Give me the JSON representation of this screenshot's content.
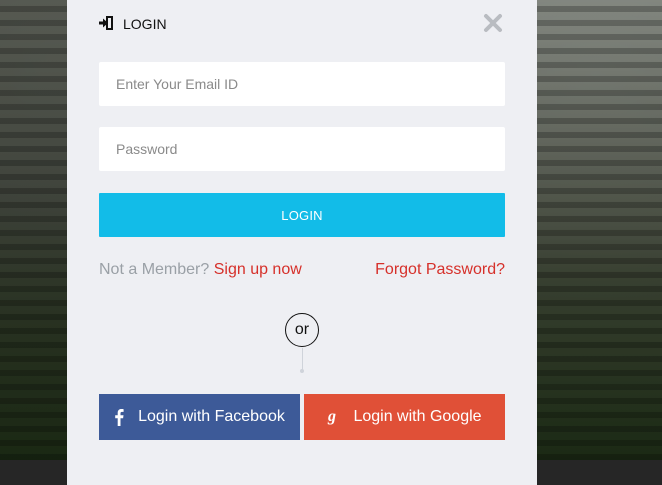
{
  "modal": {
    "title": "LOGIN",
    "email_placeholder": "Enter Your Email ID",
    "password_placeholder": "Password",
    "login_button": "LOGIN",
    "not_member_text": "Not a Member?",
    "signup_link": "Sign up now",
    "forgot_link": "Forgot Password?",
    "or_text": "or",
    "facebook_button": "Login with Facebook",
    "google_button": "Login with Google"
  },
  "icons": {
    "login": "sign-in-icon",
    "close": "close-icon",
    "facebook": "facebook-icon",
    "google": "google-icon"
  },
  "colors": {
    "accent": "#12bce8",
    "link_red": "#d6302a",
    "facebook": "#3d5a98",
    "google": "#e05037",
    "modal_bg": "#eeeff3"
  }
}
